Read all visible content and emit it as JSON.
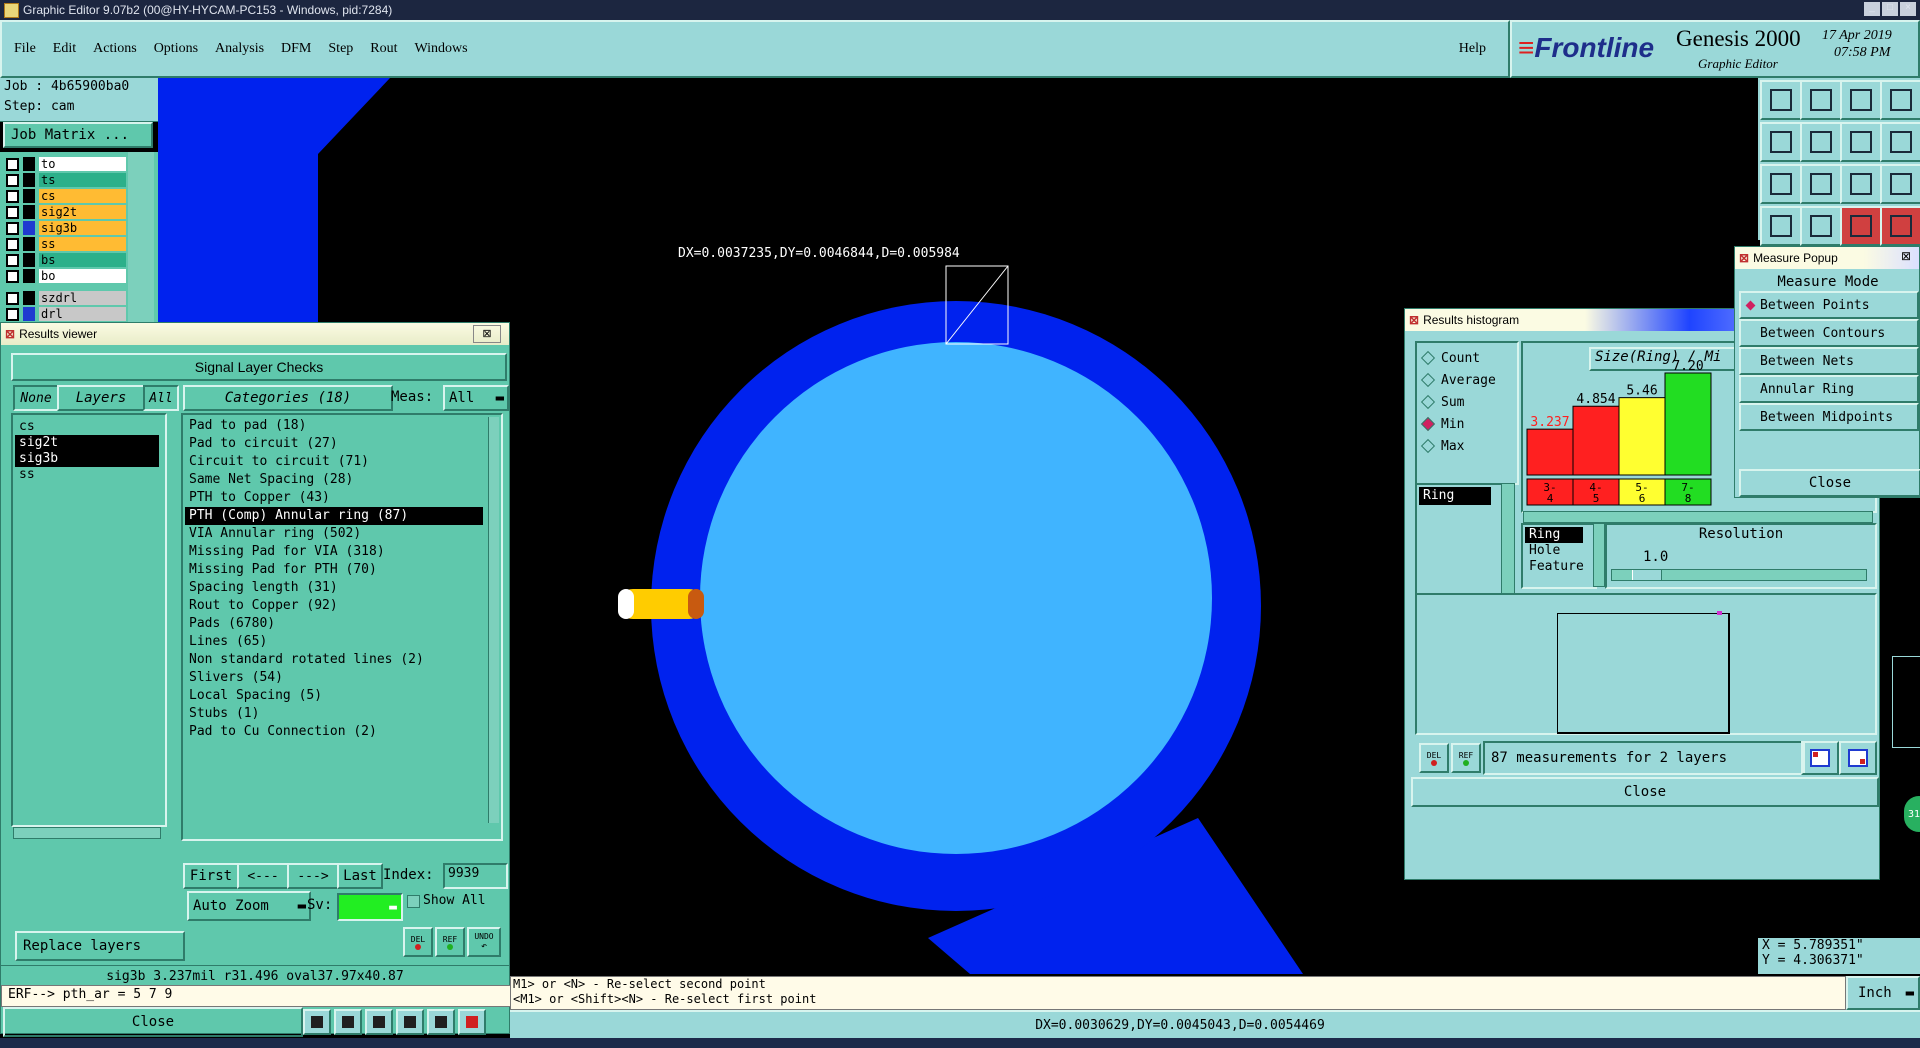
{
  "window": {
    "title": "Graphic Editor 9.07b2 (00@HY-HYCAM-PC153 - Windows, pid:7284)"
  },
  "menu": {
    "items": [
      "File",
      "Edit",
      "Actions",
      "Options",
      "Analysis",
      "DFM",
      "Step",
      "Rout",
      "Windows"
    ],
    "help": "Help"
  },
  "brand": {
    "logo": "Frontline",
    "product": "Genesis 2000",
    "sub": "Graphic Editor",
    "date": "17 Apr 2019",
    "time": "07:58 PM"
  },
  "job": {
    "job": "Job : 4b65900ba0",
    "step": "Step: cam",
    "matrix_btn": "Job Matrix ..."
  },
  "layers": [
    {
      "name": "to",
      "color": "#ffffff"
    },
    {
      "name": "ts",
      "color": "#2cb08a"
    },
    {
      "name": "cs",
      "color": "#ffbb33"
    },
    {
      "name": "sig2t",
      "color": "#ffbb33"
    },
    {
      "name": "sig3b",
      "color": "#ffbb33"
    },
    {
      "name": "ss",
      "color": "#ffbb33"
    },
    {
      "name": "bs",
      "color": "#2cb08a"
    },
    {
      "name": "bo",
      "color": "#ffffff"
    },
    {
      "name": "szdrl",
      "color": "#c8c8c8"
    },
    {
      "name": "drl",
      "color": "#c8c8c8"
    }
  ],
  "canvas": {
    "measure_text": "DX=0.0037235,DY=0.0046844,D=0.005984"
  },
  "results_viewer": {
    "title": "Results viewer",
    "header": "Signal Layer Checks",
    "none": "None",
    "layers": "Layers",
    "all": "All",
    "categories": "Categories (18)",
    "meas_label": "Meas:",
    "meas_value": "All",
    "layer_list": [
      "cs",
      "sig2t",
      "sig3b",
      "ss"
    ],
    "category_list": [
      "Pad to pad (18)",
      "Pad to circuit (27)",
      "Circuit to circuit (71)",
      "Same Net Spacing (28)",
      "PTH to Copper (43)",
      "PTH (Comp) Annular ring (87)",
      "VIA Annular ring (502)",
      "Missing Pad for VIA (318)",
      "Missing Pad for PTH (70)",
      "Spacing length (31)",
      "Rout to Copper (92)",
      "Pads (6780)",
      "Lines (65)",
      "Non standard rotated lines (2)",
      "Slivers (54)",
      "Local Spacing (5)",
      "Stubs (1)",
      "Pad to Cu Connection (2)"
    ],
    "first": "First",
    "prev": "<---",
    "next": "--->",
    "last": "Last",
    "index_label": "Index:",
    "index_value": "9939",
    "auto_zoom": "Auto Zoom",
    "sv_label": "Sv:",
    "show_all": "Show All",
    "replace_layers": "Replace layers",
    "del": "DEL",
    "ref": "REF",
    "undo": "UNDO",
    "status": "sig3b 3.237mil  r31.496  oval37.97x40.87",
    "erf": "ERF--> pth_ar = 5 7 9",
    "close": "Close"
  },
  "histogram": {
    "title": "Results histogram",
    "options": [
      "Count",
      "Average",
      "Sum",
      "Min",
      "Max"
    ],
    "selected_option": "Min",
    "chart_title": "Size(Ring) / Mi",
    "list_item": "Ring",
    "del": "DEL",
    "ref": "REF",
    "types": [
      "Ring",
      "Hole",
      "Feature"
    ],
    "resolution_label": "Resolution",
    "resolution_value": "1.0",
    "measurements": "87 measurements for 2 layers",
    "close": "Close"
  },
  "chart_data": {
    "type": "bar",
    "title": "Size(Ring) / Mi",
    "categories": [
      "3-\n4",
      "4-\n5",
      "5-\n6",
      "7-\n8"
    ],
    "values": [
      3.237,
      4.854,
      5.46,
      7.2
    ],
    "value_labels": [
      "3.237",
      "4.854",
      "5.46",
      "7.20"
    ],
    "colors": [
      "#ff2020",
      "#ff2020",
      "#ffff30",
      "#22dd22"
    ],
    "ylim": [
      0,
      7.2
    ]
  },
  "measure_popup": {
    "title": "Measure Popup",
    "header": "Measure Mode",
    "modes": [
      "Between Points",
      "Between Contours",
      "Between Nets",
      "Annular Ring",
      "Between Midpoints"
    ],
    "selected": "Between Points",
    "close": "Close"
  },
  "coords": {
    "x": "X = 5.789351\"",
    "y": "Y = 4.306371\"",
    "unit": "Inch"
  },
  "bottom": {
    "hint1": "M1> or <N> - Re-select second point",
    "hint2": "<M1> or <Shift><N> - Re-select first point",
    "status": "DX=0.0030629,DY=0.0045043,D=0.0054469"
  },
  "colors": {
    "copper": "#0022ee",
    "pad": "#40b4ff",
    "panel": "#5fc8ac",
    "light_panel": "#9ad8d8"
  }
}
